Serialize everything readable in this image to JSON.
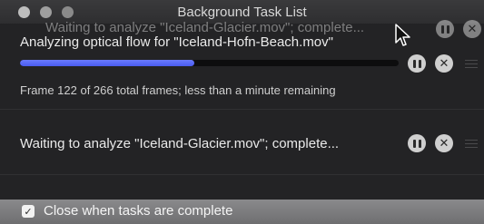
{
  "window": {
    "title": "Background Task List"
  },
  "ghost_row": {
    "text": "Waiting to analyze \"Iceland-Glacier.mov\"; complete..."
  },
  "tasks": [
    {
      "title": "Analyzing optical flow for \"Iceland-Hofn-Beach.mov\"",
      "progress": 0.46,
      "status": "Frame 122 of 266 total frames; less than a minute remaining"
    },
    {
      "title": "Waiting to analyze \"Iceland-Glacier.mov\"; complete..."
    }
  ],
  "footer": {
    "checkbox_label": "Close when tasks are complete",
    "checked": true
  },
  "colors": {
    "progress_fill": "#5566f5",
    "background": "#232325"
  }
}
